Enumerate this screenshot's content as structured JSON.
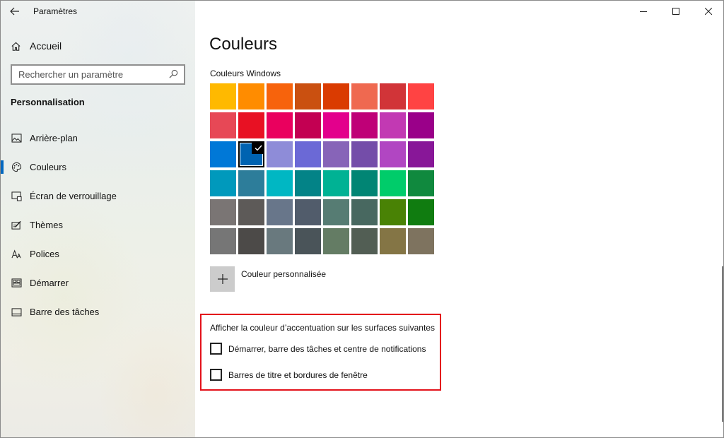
{
  "app": {
    "title": "Paramètres"
  },
  "sidebar": {
    "home_label": "Accueil",
    "search": {
      "placeholder": "Rechercher un paramètre",
      "value": ""
    },
    "section_title": "Personnalisation",
    "items": [
      {
        "label": "Arrière-plan",
        "icon": "picture-icon",
        "active": false
      },
      {
        "label": "Couleurs",
        "icon": "palette-icon",
        "active": true
      },
      {
        "label": "Écran de verrouillage",
        "icon": "lock-screen-icon",
        "active": false
      },
      {
        "label": "Thèmes",
        "icon": "themes-icon",
        "active": false
      },
      {
        "label": "Polices",
        "icon": "fonts-icon",
        "active": false
      },
      {
        "label": "Démarrer",
        "icon": "start-icon",
        "active": false
      },
      {
        "label": "Barre des tâches",
        "icon": "taskbar-icon",
        "active": false
      }
    ]
  },
  "main": {
    "title": "Couleurs",
    "windows_colors_label": "Couleurs Windows",
    "swatches": [
      "#FFB900",
      "#FF8C00",
      "#F7630C",
      "#CA5010",
      "#DA3B01",
      "#EF6950",
      "#D13438",
      "#FF4343",
      "#E74856",
      "#E81123",
      "#EA005E",
      "#C30052",
      "#E3008C",
      "#BF0077",
      "#C239B3",
      "#9A0089",
      "#0078D7",
      "#0063B1",
      "#8E8CD8",
      "#6B69D6",
      "#8764B8",
      "#744DA9",
      "#B146C2",
      "#881798",
      "#0099BC",
      "#2D7D9A",
      "#00B7C3",
      "#038387",
      "#00B294",
      "#018574",
      "#00CC6A",
      "#10893E",
      "#7A7574",
      "#5D5A58",
      "#68768A",
      "#515C6B",
      "#567C73",
      "#486860",
      "#498205",
      "#107C10",
      "#767676",
      "#4C4A48",
      "#69797E",
      "#4A5459",
      "#647C64",
      "#525E54",
      "#847545",
      "#7E735F"
    ],
    "selected_swatch_index": 17,
    "custom_color_label": "Couleur personnalisée",
    "accent_surfaces": {
      "title": "Afficher la couleur d’accentuation sur les surfaces suivantes",
      "options": [
        {
          "label": "Démarrer, barre des tâches et centre de notifications",
          "checked": false
        },
        {
          "label": "Barres de titre et bordures de fenêtre",
          "checked": false
        }
      ]
    }
  },
  "colors": {
    "accent": "#0067c0",
    "highlight_border": "#e3121b"
  }
}
